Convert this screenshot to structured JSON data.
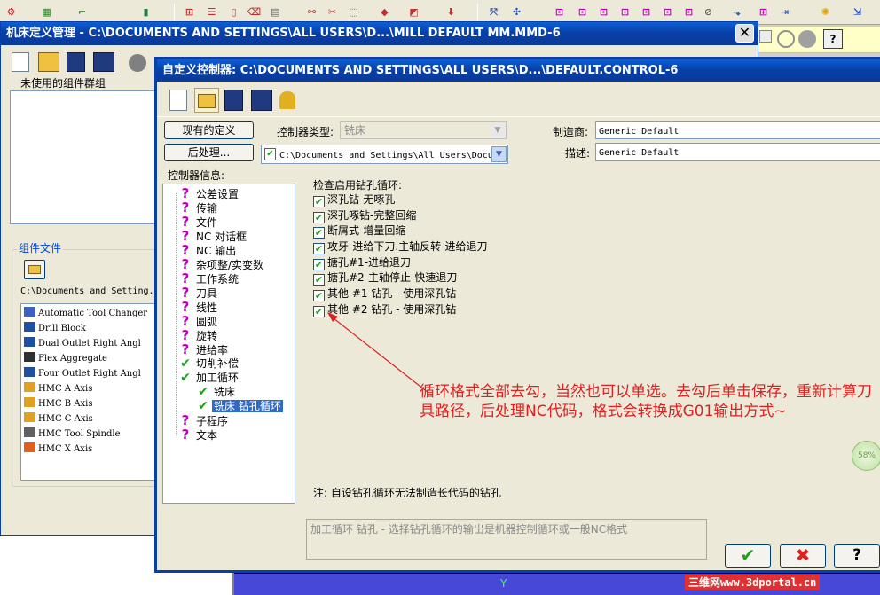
{
  "outer_window": {
    "title": "机床定义管理 - C:\\DOCUMENTS AND SETTINGS\\ALL USERS\\D...\\MILL DEFAULT MM.MMD-6",
    "unused_groups_label": "未使用的组件群组",
    "component_files_label": "组件文件",
    "path_text": "C:\\Documents and Setting...",
    "components": [
      {
        "name": "Automatic Tool Changer",
        "icon": "tool-changer-icon"
      },
      {
        "name": "Drill Block",
        "icon": "drill-block-icon"
      },
      {
        "name": "Dual Outlet Right Angl",
        "icon": "dual-outlet-icon"
      },
      {
        "name": "Flex Aggregate",
        "icon": "flex-aggregate-icon"
      },
      {
        "name": "Four Outlet Right Angl",
        "icon": "four-outlet-icon"
      },
      {
        "name": "HMC A Axis",
        "icon": "hmc-a-axis-icon"
      },
      {
        "name": "HMC B Axis",
        "icon": "hmc-b-axis-icon"
      },
      {
        "name": "HMC C Axis",
        "icon": "hmc-c-axis-icon"
      },
      {
        "name": "HMC Tool Spindle",
        "icon": "tool-spindle-icon"
      },
      {
        "name": "HMC X Axis",
        "icon": "hmc-x-axis-icon"
      }
    ]
  },
  "dialog": {
    "title": "自定义控制器: C:\\DOCUMENTS AND SETTINGS\\ALL USERS\\D...\\DEFAULT.CONTROL-6",
    "existing_def_button": "现有的定义",
    "post_button": "后处理",
    "controller_type_label": "控制器类型:",
    "controller_type_value": "铣床",
    "post_path": "C:\\Documents and Settings\\All Users\\Docu",
    "manufacturer_label": "制造商:",
    "manufacturer_value": "Generic Default",
    "description_label": "描述:",
    "description_value": "Generic Default",
    "controller_info_label": "控制器信息:",
    "tree": [
      {
        "label": "公差设置",
        "state": "question",
        "indent": 0
      },
      {
        "label": "传输",
        "state": "question",
        "indent": 0
      },
      {
        "label": "文件",
        "state": "question",
        "indent": 0
      },
      {
        "label": "NC 对话框",
        "state": "question",
        "indent": 0
      },
      {
        "label": "NC 输出",
        "state": "question",
        "indent": 0
      },
      {
        "label": "杂项整/实变数",
        "state": "question",
        "indent": 0
      },
      {
        "label": "工作系统",
        "state": "question",
        "indent": 0
      },
      {
        "label": "刀具",
        "state": "question",
        "indent": 0
      },
      {
        "label": "线性",
        "state": "question",
        "indent": 0
      },
      {
        "label": "圆弧",
        "state": "question",
        "indent": 0
      },
      {
        "label": "旋转",
        "state": "question",
        "indent": 0
      },
      {
        "label": "进给率",
        "state": "question",
        "indent": 0
      },
      {
        "label": "切削补偿",
        "state": "check",
        "indent": 0
      },
      {
        "label": "加工循环",
        "state": "check",
        "indent": 0
      },
      {
        "label": "铣床",
        "state": "check",
        "indent": 1
      },
      {
        "label": "铣床 钻孔循环",
        "state": "check",
        "indent": 1,
        "selected": true
      },
      {
        "label": "子程序",
        "state": "question",
        "indent": 0
      },
      {
        "label": "文本",
        "state": "question",
        "indent": 0
      }
    ],
    "check_group_title": "检查启用钻孔循环:",
    "checks": [
      {
        "label": "深孔钻-无啄孔",
        "checked": true
      },
      {
        "label": "深孔啄钻-完整回缩",
        "checked": true
      },
      {
        "label": "断屑式-增量回缩",
        "checked": true
      },
      {
        "label": "攻牙-进给下刀.主轴反转-进给退刀",
        "checked": true
      },
      {
        "label": "搪孔#1-进给退刀",
        "checked": true
      },
      {
        "label": "搪孔#2-主轴停止-快速退刀",
        "checked": true
      },
      {
        "label": "其他 #1 钻孔 - 使用深孔钻",
        "checked": true
      },
      {
        "label": "其他 #2 钻孔 - 使用深孔钻",
        "checked": true
      }
    ],
    "annotation": "循环格式全部去勾，当然也可以单选。去勾后单击保存，重新计算刀具路径，后处理NC代码，格式会转换成G01输出方式~",
    "note": "注: 自设钻孔循环无法制造长代码的钻孔",
    "help_text": "加工循环 钻孔 - 选择钻孔循环的输出是机器控制循环或一般NC格式",
    "progress_badge": "58%",
    "watermark": "三维网www.3dportal.cn"
  },
  "colors": {
    "accent": "#0a5fd8",
    "annotation_red": "#e02020"
  }
}
